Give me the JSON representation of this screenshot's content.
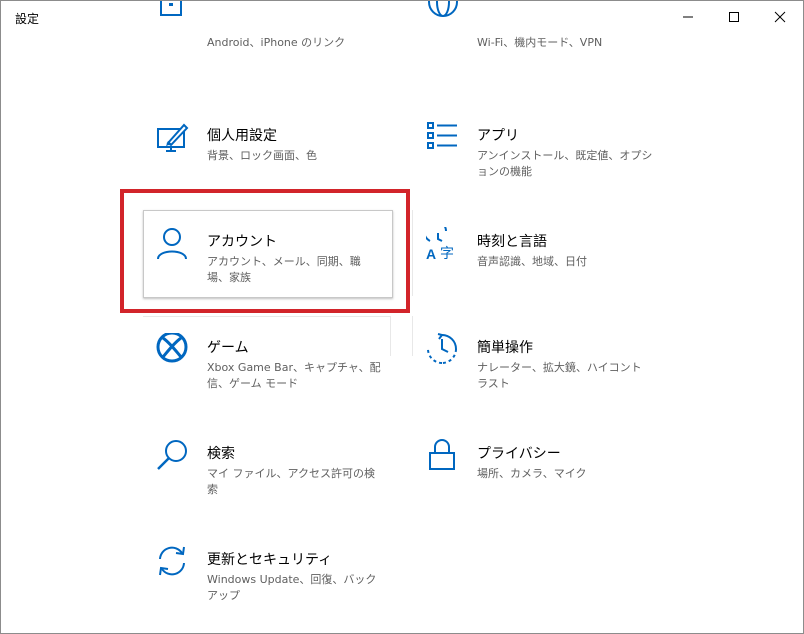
{
  "window": {
    "title": "設定",
    "minimize_glyph": "─",
    "maximize_glyph": "☐",
    "close_glyph": "✕"
  },
  "colors": {
    "accent": "#0067c0",
    "highlight_border": "#d2242a",
    "text": "#000000",
    "subtext": "#5f5f5f"
  },
  "settings": {
    "phone": {
      "desc": "Android、iPhone のリンク",
      "icon": "phone-icon"
    },
    "network": {
      "desc": "Wi-Fi、機内モード、VPN",
      "icon": "globe-icon"
    },
    "personalization": {
      "name": "個人用設定",
      "desc": "背景、ロック画面、色",
      "icon": "personalization-icon"
    },
    "apps": {
      "name": "アプリ",
      "desc": "アンインストール、既定値、オプションの機能",
      "icon": "apps-list-icon"
    },
    "accounts": {
      "name": "アカウント",
      "desc": "アカウント、メール、同期、職場、家族",
      "icon": "person-icon"
    },
    "time_language": {
      "name": "時刻と言語",
      "desc": "音声認識、地域、日付",
      "icon": "time-language-icon"
    },
    "gaming": {
      "name": "ゲーム",
      "desc": "Xbox Game Bar、キャプチャ、配信、ゲーム モード",
      "icon": "xbox-icon"
    },
    "ease_of_access": {
      "name": "簡単操作",
      "desc": "ナレーター、拡大鏡、ハイコントラスト",
      "icon": "ease-of-access-icon"
    },
    "search": {
      "name": "検索",
      "desc": "マイ ファイル、アクセス許可の検索",
      "icon": "search-icon"
    },
    "privacy": {
      "name": "プライバシー",
      "desc": "場所、カメラ、マイク",
      "icon": "lock-icon"
    },
    "update_security": {
      "name": "更新とセキュリティ",
      "desc": "Windows Update、回復、バックアップ",
      "icon": "sync-icon"
    }
  }
}
